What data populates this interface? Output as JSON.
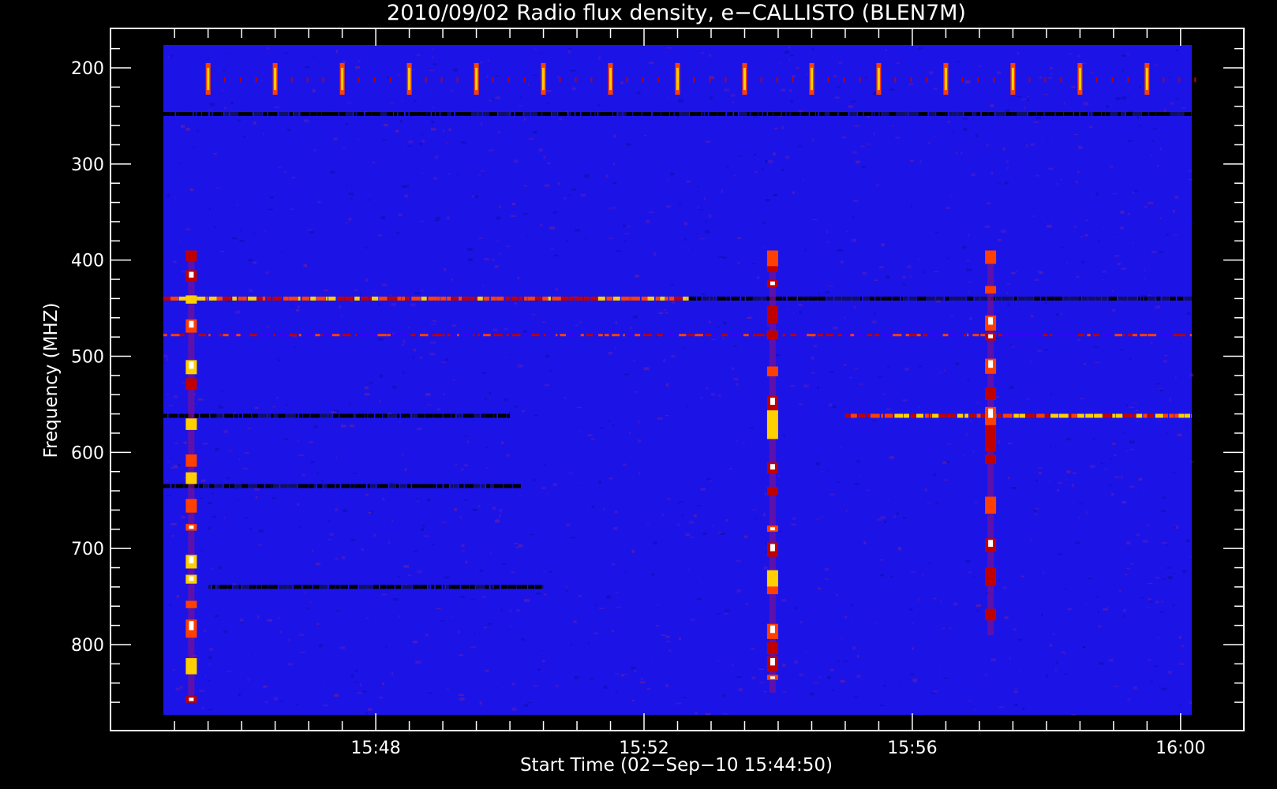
{
  "chart_data": {
    "type": "heatmap",
    "title": "2010/09/02  Radio flux density, e−CALLISTO (BLEN7M)",
    "xlabel": "Start Time (02−Sep−10 15:44:50)",
    "ylabel": "Frequency (MHZ)",
    "x_start": "15:44:50",
    "x_end": "16:00:10",
    "x_ticks": [
      "15:48",
      "15:52",
      "15:56",
      "16:00"
    ],
    "y_ticks": [
      200,
      300,
      400,
      500,
      600,
      700,
      800
    ],
    "ylim": [
      875,
      175
    ],
    "y_inverted": true,
    "background_color": "#1c14e6",
    "colormap": [
      "#000000",
      "#3a00ff",
      "#c00000",
      "#ff4000",
      "#ffd000",
      "#ffffff"
    ],
    "bands": [
      {
        "freq_mhz": 440,
        "intensity": "high",
        "time_range": [
          "15:44:50",
          "15:52:40"
        ]
      },
      {
        "freq_mhz": 440,
        "intensity": "absorption",
        "time_range": [
          "15:52:40",
          "16:00:10"
        ]
      },
      {
        "freq_mhz": 562,
        "intensity": "absorption",
        "time_range": [
          "15:44:50",
          "15:50:00"
        ]
      },
      {
        "freq_mhz": 562,
        "intensity": "high",
        "time_range": [
          "15:55:00",
          "16:00:10"
        ]
      },
      {
        "freq_mhz": 478,
        "intensity": "medium",
        "time_range": [
          "15:44:50",
          "16:00:10"
        ]
      },
      {
        "freq_mhz": 248,
        "intensity": "absorption",
        "time_range": [
          "15:44:50",
          "16:00:10"
        ]
      },
      {
        "freq_mhz": 635,
        "intensity": "absorption",
        "time_range": [
          "15:44:50",
          "15:50:10"
        ]
      },
      {
        "freq_mhz": 740,
        "intensity": "absorption",
        "time_range": [
          "15:45:30",
          "15:50:30"
        ]
      }
    ],
    "bursts": [
      {
        "time": "15:45:15",
        "freq_range_mhz": [
          390,
          860
        ],
        "intensity": "high"
      },
      {
        "time": "15:53:55",
        "freq_range_mhz": [
          390,
          850
        ],
        "intensity": "high"
      },
      {
        "time": "15:57:10",
        "freq_range_mhz": [
          390,
          790
        ],
        "intensity": "high"
      }
    ],
    "interference_freq_range_mhz": [
      195,
      228
    ],
    "interference_period_s": 60
  }
}
